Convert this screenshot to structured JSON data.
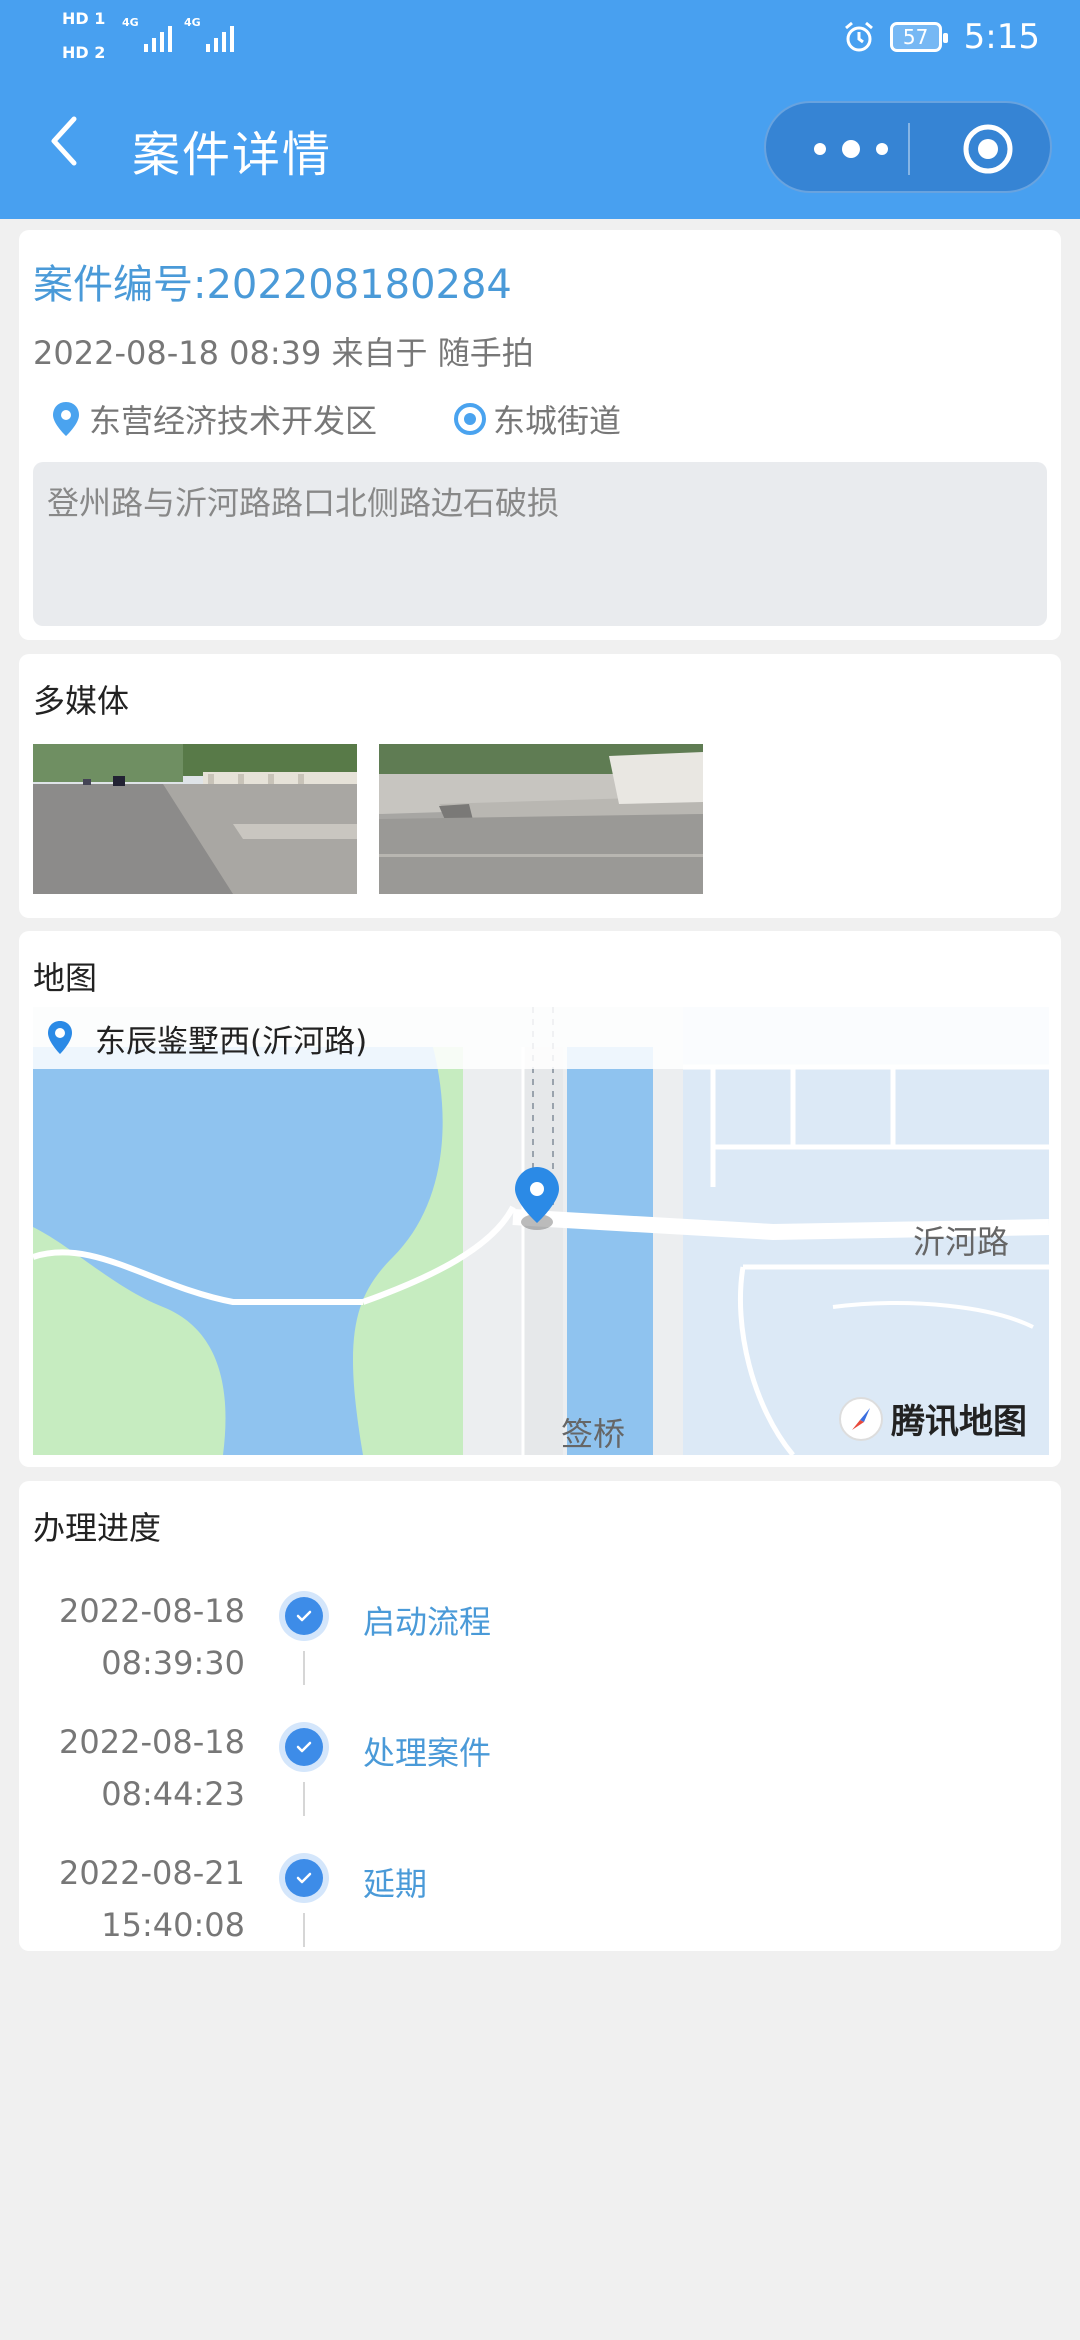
{
  "status_bar": {
    "hd1": "HD 1",
    "hd2": "HD 2",
    "net1": "4G",
    "net2": "4G",
    "battery": "57",
    "time": "5:15"
  },
  "nav": {
    "title": "案件详情",
    "back_icon": "chevron-left-icon",
    "more_icon": "more-dots-icon",
    "close_icon": "target-circle-icon"
  },
  "case": {
    "number_text": "案件编号:202208180284",
    "meta": "2022-08-18 08:39 来自于 随手拍",
    "district": "东营经济技术开发区",
    "street": "东城街道",
    "description": "登州路与沂河路路口北侧路边石破损"
  },
  "media": {
    "title": "多媒体"
  },
  "map": {
    "title": "地图",
    "place": "东辰鉴墅西(沂河路)",
    "road_label": "沂河路",
    "bridge_label": "签桥",
    "logo_text": "腾讯地图"
  },
  "progress": {
    "title": "办理进度",
    "items": [
      {
        "date": "2022-08-18",
        "time": "08:39:30",
        "label": "启动流程"
      },
      {
        "date": "2022-08-18",
        "time": "08:44:23",
        "label": "处理案件"
      },
      {
        "date": "2022-08-21",
        "time": "15:40:08",
        "label": "延期"
      }
    ]
  },
  "colors": {
    "header": "#48a0f0",
    "accent": "#4a9ad8",
    "water": "#8fc3ef",
    "green": "#c6ecc0"
  }
}
